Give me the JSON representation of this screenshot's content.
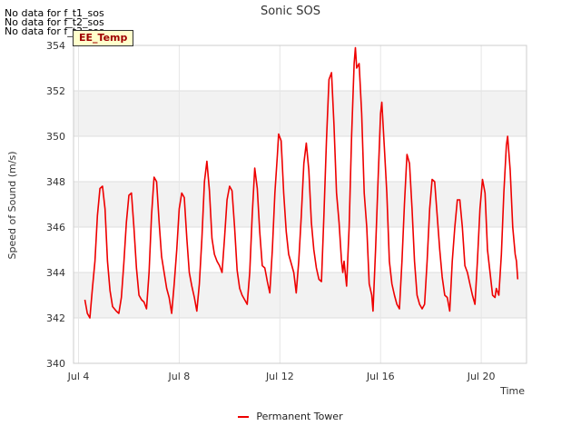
{
  "page": {
    "no_data_lines": [
      "No data for f_t1_sos",
      "No data for f_t2_sos",
      "No data for f_t3_sos"
    ],
    "tag_label": "EE_Temp"
  },
  "chart_data": {
    "type": "line",
    "title": "Sonic SOS",
    "xlabel": "Time",
    "ylabel": "Speed of Sound (m/s)",
    "ylim": [
      340,
      354
    ],
    "xlim": [
      3.8,
      21.8
    ],
    "y_ticks": [
      340,
      342,
      344,
      346,
      348,
      350,
      352,
      354
    ],
    "x_ticks": [
      {
        "value": 4,
        "label": "Jul 4"
      },
      {
        "value": 8,
        "label": "Jul 8"
      },
      {
        "value": 12,
        "label": "Jul 12"
      },
      {
        "value": 16,
        "label": "Jul 16"
      },
      {
        "value": 20,
        "label": "Jul 20"
      }
    ],
    "grid": true,
    "band_color": "#f2f2f2",
    "series": [
      {
        "name": "Permanent Tower",
        "color": "#ee0000",
        "points": [
          [
            4.25,
            342.8
          ],
          [
            4.35,
            342.2
          ],
          [
            4.45,
            342.0
          ],
          [
            4.55,
            343.3
          ],
          [
            4.65,
            344.5
          ],
          [
            4.75,
            346.5
          ],
          [
            4.85,
            347.7
          ],
          [
            4.95,
            347.8
          ],
          [
            5.05,
            346.8
          ],
          [
            5.15,
            344.5
          ],
          [
            5.25,
            343.2
          ],
          [
            5.35,
            342.5
          ],
          [
            5.5,
            342.3
          ],
          [
            5.6,
            342.2
          ],
          [
            5.7,
            342.9
          ],
          [
            5.8,
            344.4
          ],
          [
            5.9,
            346.2
          ],
          [
            6.0,
            347.4
          ],
          [
            6.1,
            347.5
          ],
          [
            6.2,
            346.0
          ],
          [
            6.3,
            344.2
          ],
          [
            6.4,
            343.0
          ],
          [
            6.5,
            342.8
          ],
          [
            6.6,
            342.7
          ],
          [
            6.7,
            342.4
          ],
          [
            6.8,
            344.0
          ],
          [
            6.9,
            346.5
          ],
          [
            7.0,
            348.2
          ],
          [
            7.1,
            348.0
          ],
          [
            7.2,
            346.2
          ],
          [
            7.3,
            344.7
          ],
          [
            7.4,
            344.0
          ],
          [
            7.5,
            343.3
          ],
          [
            7.6,
            342.9
          ],
          [
            7.7,
            342.2
          ],
          [
            7.8,
            343.5
          ],
          [
            7.9,
            345.0
          ],
          [
            8.0,
            346.8
          ],
          [
            8.1,
            347.5
          ],
          [
            8.2,
            347.3
          ],
          [
            8.3,
            345.5
          ],
          [
            8.4,
            344.0
          ],
          [
            8.5,
            343.4
          ],
          [
            8.6,
            342.9
          ],
          [
            8.7,
            342.3
          ],
          [
            8.8,
            343.5
          ],
          [
            8.9,
            345.5
          ],
          [
            9.0,
            348.0
          ],
          [
            9.1,
            348.9
          ],
          [
            9.2,
            347.6
          ],
          [
            9.3,
            345.5
          ],
          [
            9.4,
            344.8
          ],
          [
            9.5,
            344.5
          ],
          [
            9.6,
            344.3
          ],
          [
            9.7,
            344.0
          ],
          [
            9.8,
            345.5
          ],
          [
            9.9,
            347.2
          ],
          [
            10.0,
            347.8
          ],
          [
            10.1,
            347.6
          ],
          [
            10.2,
            346.0
          ],
          [
            10.3,
            344.1
          ],
          [
            10.4,
            343.3
          ],
          [
            10.5,
            343.0
          ],
          [
            10.6,
            342.8
          ],
          [
            10.7,
            342.6
          ],
          [
            10.8,
            344.0
          ],
          [
            10.9,
            346.5
          ],
          [
            11.0,
            348.6
          ],
          [
            11.1,
            347.7
          ],
          [
            11.2,
            345.8
          ],
          [
            11.3,
            344.3
          ],
          [
            11.4,
            344.2
          ],
          [
            11.5,
            343.6
          ],
          [
            11.6,
            343.1
          ],
          [
            11.7,
            345.0
          ],
          [
            11.8,
            347.5
          ],
          [
            11.9,
            349.2
          ],
          [
            11.95,
            350.1
          ],
          [
            12.05,
            349.8
          ],
          [
            12.15,
            347.5
          ],
          [
            12.25,
            345.8
          ],
          [
            12.35,
            344.8
          ],
          [
            12.45,
            344.4
          ],
          [
            12.55,
            344.0
          ],
          [
            12.65,
            343.1
          ],
          [
            12.75,
            344.5
          ],
          [
            12.85,
            346.5
          ],
          [
            12.95,
            348.8
          ],
          [
            13.05,
            349.7
          ],
          [
            13.15,
            348.5
          ],
          [
            13.25,
            346.2
          ],
          [
            13.35,
            345.0
          ],
          [
            13.45,
            344.2
          ],
          [
            13.55,
            343.7
          ],
          [
            13.65,
            343.6
          ],
          [
            13.75,
            346.5
          ],
          [
            13.85,
            349.8
          ],
          [
            13.95,
            352.5
          ],
          [
            14.05,
            352.8
          ],
          [
            14.15,
            350.5
          ],
          [
            14.25,
            347.5
          ],
          [
            14.35,
            346.2
          ],
          [
            14.45,
            344.5
          ],
          [
            14.5,
            344.0
          ],
          [
            14.55,
            344.5
          ],
          [
            14.65,
            343.4
          ],
          [
            14.75,
            346.0
          ],
          [
            14.85,
            350.0
          ],
          [
            14.95,
            353.2
          ],
          [
            15.0,
            353.9
          ],
          [
            15.05,
            353.0
          ],
          [
            15.15,
            353.2
          ],
          [
            15.25,
            351.0
          ],
          [
            15.35,
            347.5
          ],
          [
            15.45,
            346.0
          ],
          [
            15.55,
            343.5
          ],
          [
            15.65,
            343.0
          ],
          [
            15.7,
            342.3
          ],
          [
            15.8,
            345.0
          ],
          [
            15.9,
            348.0
          ],
          [
            16.0,
            351.0
          ],
          [
            16.05,
            351.5
          ],
          [
            16.15,
            349.5
          ],
          [
            16.25,
            347.5
          ],
          [
            16.35,
            344.5
          ],
          [
            16.45,
            343.5
          ],
          [
            16.55,
            343.0
          ],
          [
            16.65,
            342.6
          ],
          [
            16.75,
            342.4
          ],
          [
            16.85,
            344.5
          ],
          [
            16.95,
            347.0
          ],
          [
            17.05,
            349.2
          ],
          [
            17.15,
            348.8
          ],
          [
            17.25,
            346.8
          ],
          [
            17.35,
            344.5
          ],
          [
            17.45,
            343.0
          ],
          [
            17.55,
            342.6
          ],
          [
            17.65,
            342.4
          ],
          [
            17.75,
            342.6
          ],
          [
            17.85,
            344.5
          ],
          [
            17.95,
            346.8
          ],
          [
            18.05,
            348.1
          ],
          [
            18.15,
            348.0
          ],
          [
            18.25,
            346.5
          ],
          [
            18.35,
            345.0
          ],
          [
            18.45,
            343.8
          ],
          [
            18.55,
            343.0
          ],
          [
            18.65,
            342.9
          ],
          [
            18.75,
            342.3
          ],
          [
            18.85,
            344.5
          ],
          [
            18.95,
            346.0
          ],
          [
            19.05,
            347.2
          ],
          [
            19.15,
            347.2
          ],
          [
            19.25,
            346.0
          ],
          [
            19.35,
            344.3
          ],
          [
            19.45,
            344.0
          ],
          [
            19.55,
            343.5
          ],
          [
            19.65,
            343.0
          ],
          [
            19.75,
            342.6
          ],
          [
            19.85,
            344.5
          ],
          [
            19.95,
            346.8
          ],
          [
            20.05,
            348.1
          ],
          [
            20.15,
            347.5
          ],
          [
            20.25,
            345.0
          ],
          [
            20.35,
            344.0
          ],
          [
            20.45,
            343.0
          ],
          [
            20.55,
            342.9
          ],
          [
            20.6,
            343.3
          ],
          [
            20.7,
            343.0
          ],
          [
            20.8,
            344.8
          ],
          [
            20.9,
            347.5
          ],
          [
            21.0,
            349.6
          ],
          [
            21.05,
            350.0
          ],
          [
            21.15,
            348.5
          ],
          [
            21.25,
            346.0
          ],
          [
            21.35,
            344.8
          ],
          [
            21.4,
            344.5
          ],
          [
            21.45,
            343.7
          ]
        ]
      }
    ]
  }
}
